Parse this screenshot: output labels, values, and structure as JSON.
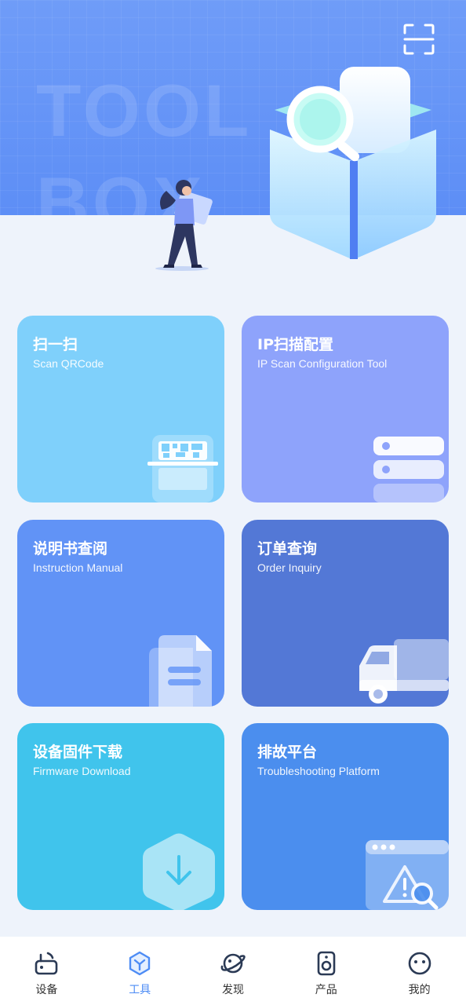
{
  "hero": {
    "watermark_line1": "TOOL",
    "watermark_line2": "BOX"
  },
  "cards": [
    {
      "title": "扫一扫",
      "subtitle": "Scan QRCode",
      "icon": "qr-code-icon",
      "color": "#7fd0fb"
    },
    {
      "title": "IP扫描配置",
      "subtitle": "IP Scan Configuration Tool",
      "icon": "server-icon",
      "color": "#8ea3fb"
    },
    {
      "title": "说明书查阅",
      "subtitle": "Instruction Manual",
      "icon": "document-icon",
      "color": "#6193f6"
    },
    {
      "title": "订单查询",
      "subtitle": "Order Inquiry",
      "icon": "truck-icon",
      "color": "#5378d6"
    },
    {
      "title": "设备固件下载",
      "subtitle": "Firmware Download",
      "icon": "download-icon",
      "color": "#40c4ec"
    },
    {
      "title": "排故平台",
      "subtitle": "Troubleshooting Platform",
      "icon": "warning-window-icon",
      "color": "#4b8eee"
    }
  ],
  "nav": [
    {
      "label": "设备",
      "icon": "router-icon",
      "active": false
    },
    {
      "label": "工具",
      "icon": "toolbox-icon",
      "active": true
    },
    {
      "label": "发现",
      "icon": "planet-icon",
      "active": false
    },
    {
      "label": "产品",
      "icon": "speaker-icon",
      "active": false
    },
    {
      "label": "我的",
      "icon": "face-icon",
      "active": false
    }
  ],
  "colors": {
    "hero_bg": "#6f9cf8",
    "page_bg": "#eef3fb",
    "nav_active": "#4d8cf5",
    "nav_inactive": "#333333"
  }
}
